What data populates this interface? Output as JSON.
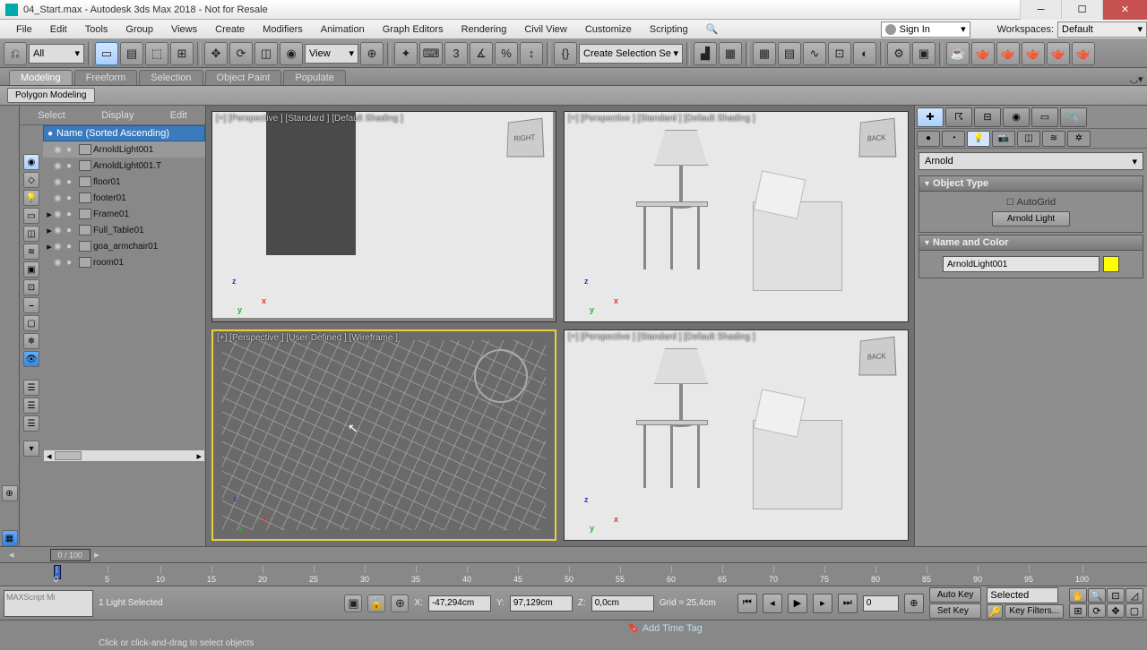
{
  "titlebar": {
    "text": "04_Start.max - Autodesk 3ds Max 2018 - Not for Resale"
  },
  "menu": [
    "File",
    "Edit",
    "Tools",
    "Group",
    "Views",
    "Create",
    "Modifiers",
    "Animation",
    "Graph Editors",
    "Rendering",
    "Civil View",
    "Customize",
    "Scripting"
  ],
  "signin": {
    "label": "Sign In"
  },
  "workspace": {
    "lbl": "Workspaces:",
    "val": "Default"
  },
  "toolbar": {
    "all": "All",
    "view": "View",
    "sel_set": "Create Selection Se"
  },
  "ribbon": [
    "Modeling",
    "Freeform",
    "Selection",
    "Object Paint",
    "Populate"
  ],
  "subribbon": {
    "btn": "Polygon Modeling"
  },
  "scene_menu": [
    "Select",
    "Display",
    "Edit"
  ],
  "outliner": {
    "header": "Name (Sorted Ascending)",
    "rows": [
      {
        "name": "ArnoldLight001",
        "sel": true,
        "expand": ""
      },
      {
        "name": "ArnoldLight001.T",
        "sel": false,
        "expand": ""
      },
      {
        "name": "floor01",
        "sel": false,
        "expand": ""
      },
      {
        "name": "footer01",
        "sel": false,
        "expand": ""
      },
      {
        "name": "Frame01",
        "sel": false,
        "expand": "▸"
      },
      {
        "name": "Full_Table01",
        "sel": false,
        "expand": "▸"
      },
      {
        "name": "goa_armchair01",
        "sel": false,
        "expand": "▸"
      },
      {
        "name": "room01",
        "sel": false,
        "expand": ""
      }
    ]
  },
  "viewports": {
    "tl": "[+] [Perspective ] [Standard ] [Default Shading ]",
    "tr": "[+] [Perspective ] [Standard ] [Default Shading ]",
    "bl": "[+] [Perspective ] [User-Defined ] [Wireframe ]",
    "br": "[+] [Perspective ] [Standard ] [Default Shading ]",
    "cube1": "RIGHT",
    "cube2": "BACK",
    "cube3": "BACK"
  },
  "cmd": {
    "renderer": "Arnold",
    "r1": {
      "title": "Object Type",
      "autogrid": "AutoGrid",
      "btn": "Arnold Light"
    },
    "r2": {
      "title": "Name and Color",
      "name": "ArnoldLight001"
    }
  },
  "timeline": {
    "indicator": "0 / 100",
    "ticks": [
      0,
      5,
      10,
      15,
      20,
      25,
      30,
      35,
      40,
      45,
      50,
      55,
      60,
      65,
      70,
      75,
      80,
      85,
      90,
      95,
      100
    ]
  },
  "status": {
    "script": "MAXScript Mi",
    "sel": "1 Light Selected",
    "prompt": "Click or click-and-drag to select objects",
    "x": "-47,294cm",
    "y": "97,129cm",
    "z": "0,0cm",
    "grid": "Grid = 25,4cm",
    "autokey": "Auto Key",
    "setkey": "Set Key",
    "selected": "Selected",
    "keyfilters": "Key Filters...",
    "tag": "Add Time Tag"
  }
}
